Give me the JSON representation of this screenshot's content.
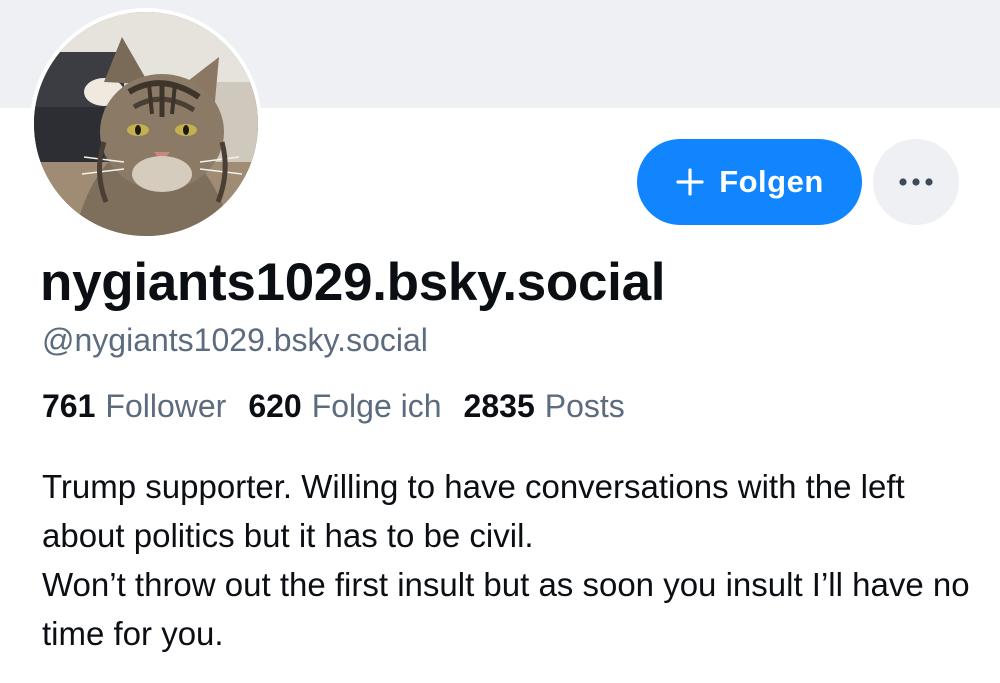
{
  "profile": {
    "display_name": "nygiants1029.bsky.social",
    "handle": "@nygiants1029.bsky.social",
    "avatar_icon": "cat-avatar",
    "bio": "Trump supporter.  Willing to have conversations with the left about politics but it has to be civil.\nWon’t throw out the first insult but as soon you insult I’ll have no time for you."
  },
  "actions": {
    "follow_label": "Folgen",
    "follow_icon": "plus-icon",
    "more_icon": "ellipsis-icon"
  },
  "stats": [
    {
      "count": "761",
      "label": "Follower"
    },
    {
      "count": "620",
      "label": "Folge ich"
    },
    {
      "count": "2835",
      "label": "Posts"
    }
  ],
  "colors": {
    "accent": "#1185fe",
    "banner": "#eef0f3",
    "muted_text": "#5c6b7d",
    "text": "#0b0f14"
  }
}
